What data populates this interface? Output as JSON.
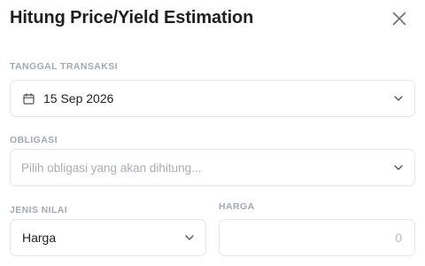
{
  "dialog": {
    "title": "Hitung Price/Yield Estimation"
  },
  "fields": {
    "tanggal": {
      "label": "TANGGAL TRANSAKSI",
      "value": "15 Sep 2026"
    },
    "obligasi": {
      "label": "OBLIGASI",
      "placeholder": "Pilih obligasi yang akan dihitung..."
    },
    "jenis_nilai": {
      "label": "JENIS NILAI",
      "value": "Harga"
    },
    "harga": {
      "label": "HARGA",
      "value": "",
      "placeholder": "0"
    }
  },
  "icons": {
    "close": "close-icon",
    "calendar": "calendar-icon",
    "chevron": "chevron-down-icon"
  },
  "colors": {
    "label": "#a3a8b0",
    "border": "#e2e4e8",
    "placeholder": "#a9adb4",
    "text": "#222222"
  }
}
